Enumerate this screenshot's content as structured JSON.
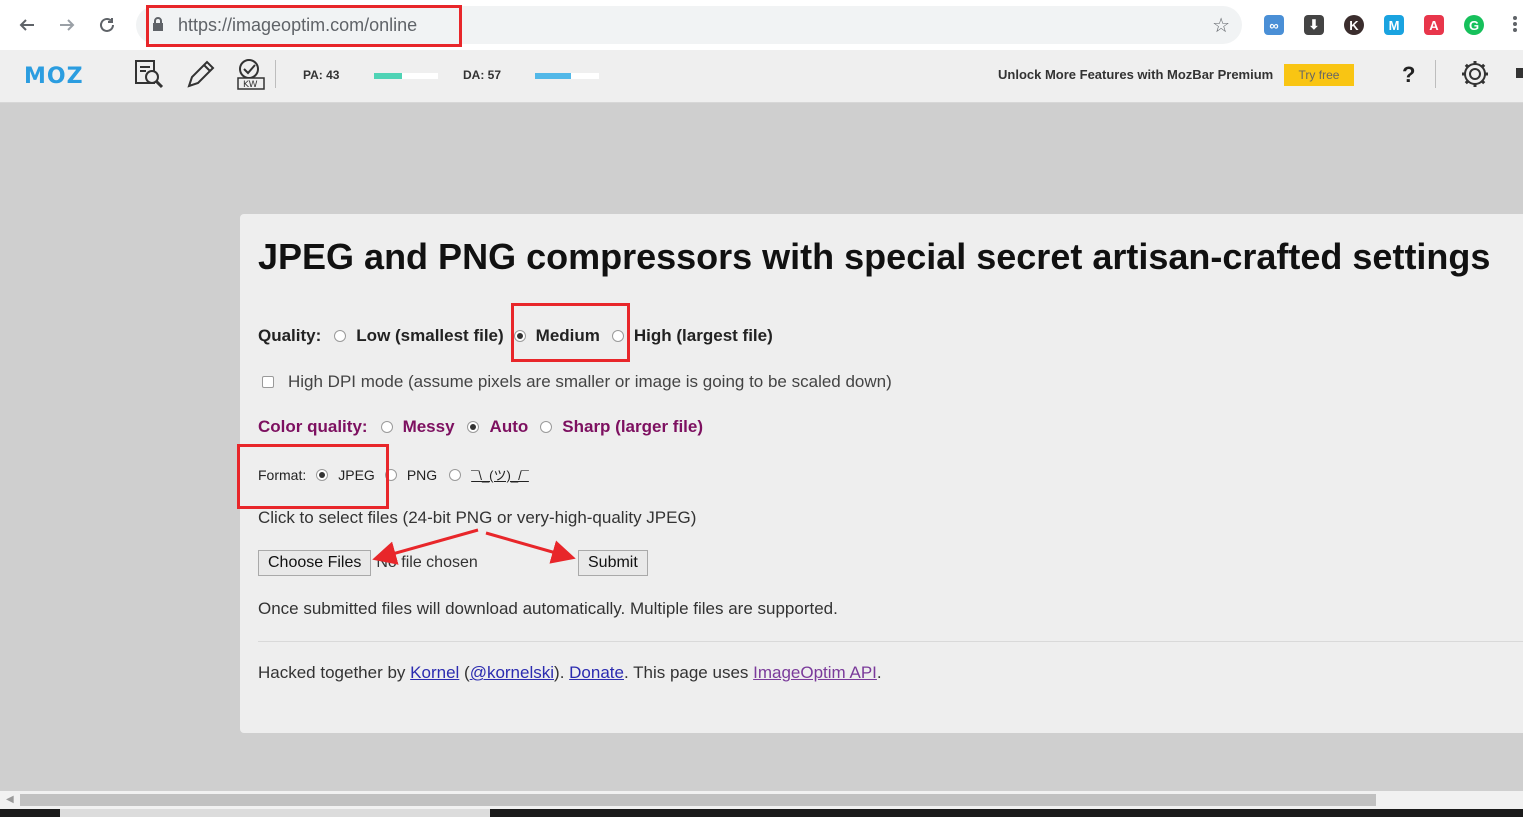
{
  "browser": {
    "url": "https://imageoptim.com/online",
    "extensions": [
      {
        "name": "link-ext-icon",
        "color": "#4a8fd6",
        "glyph": "∞"
      },
      {
        "name": "download-ext-icon",
        "color": "#444444",
        "glyph": "⬇"
      },
      {
        "name": "k-ext-icon",
        "color": "#3b2d2d",
        "glyph": "K"
      },
      {
        "name": "m-ext-icon",
        "color": "#1aa3e0",
        "glyph": "M"
      },
      {
        "name": "acrobat-ext-icon",
        "color": "#e8364b",
        "glyph": "A"
      },
      {
        "name": "grammarly-ext-icon",
        "color": "#16c05b",
        "glyph": "G"
      }
    ]
  },
  "mozbar": {
    "logo": "MOZ",
    "pa_label": "PA: 43",
    "pa_value": 43,
    "da_label": "DA: 57",
    "da_value": 57,
    "upsell": "Unlock More Features with MozBar Premium",
    "try_free": "Try free",
    "help": "?",
    "colors": {
      "pa": "#4fd3b5",
      "da": "#52b8e8",
      "try_free_bg": "#f9c513",
      "logo": "#2b9de0"
    }
  },
  "page": {
    "title": "JPEG and PNG compressors with special secret artisan-crafted settings",
    "quality": {
      "label": "Quality:",
      "options": [
        "Low (smallest file)",
        "Medium",
        "High (largest file)"
      ],
      "selected": "Medium"
    },
    "high_dpi": {
      "label": "High DPI mode (assume pixels are smaller or image is going to be scaled down)",
      "checked": false
    },
    "color_quality": {
      "label": "Color quality:",
      "options": [
        "Messy",
        "Auto",
        "Sharp (larger file)"
      ],
      "selected": "Auto"
    },
    "format": {
      "label": "Format:",
      "options": [
        "JPEG",
        "PNG",
        "¯\\_(ツ)_/¯"
      ],
      "selected": "JPEG"
    },
    "select_hint": "Click to select files (24-bit PNG or very-high-quality JPEG)",
    "choose_files": "Choose Files",
    "no_file": "No file chosen",
    "submit": "Submit",
    "note": "Once submitted files will download automatically. Multiple files are supported.",
    "footer": {
      "prefix": "Hacked together by ",
      "author": "Kornel",
      "open_paren": " (",
      "handle": "@kornelski",
      "close": "). ",
      "donate": "Donate",
      "mid": ". This page uses ",
      "api": "ImageOptim API",
      "end": "."
    }
  },
  "annotation_color": "#e8262a"
}
